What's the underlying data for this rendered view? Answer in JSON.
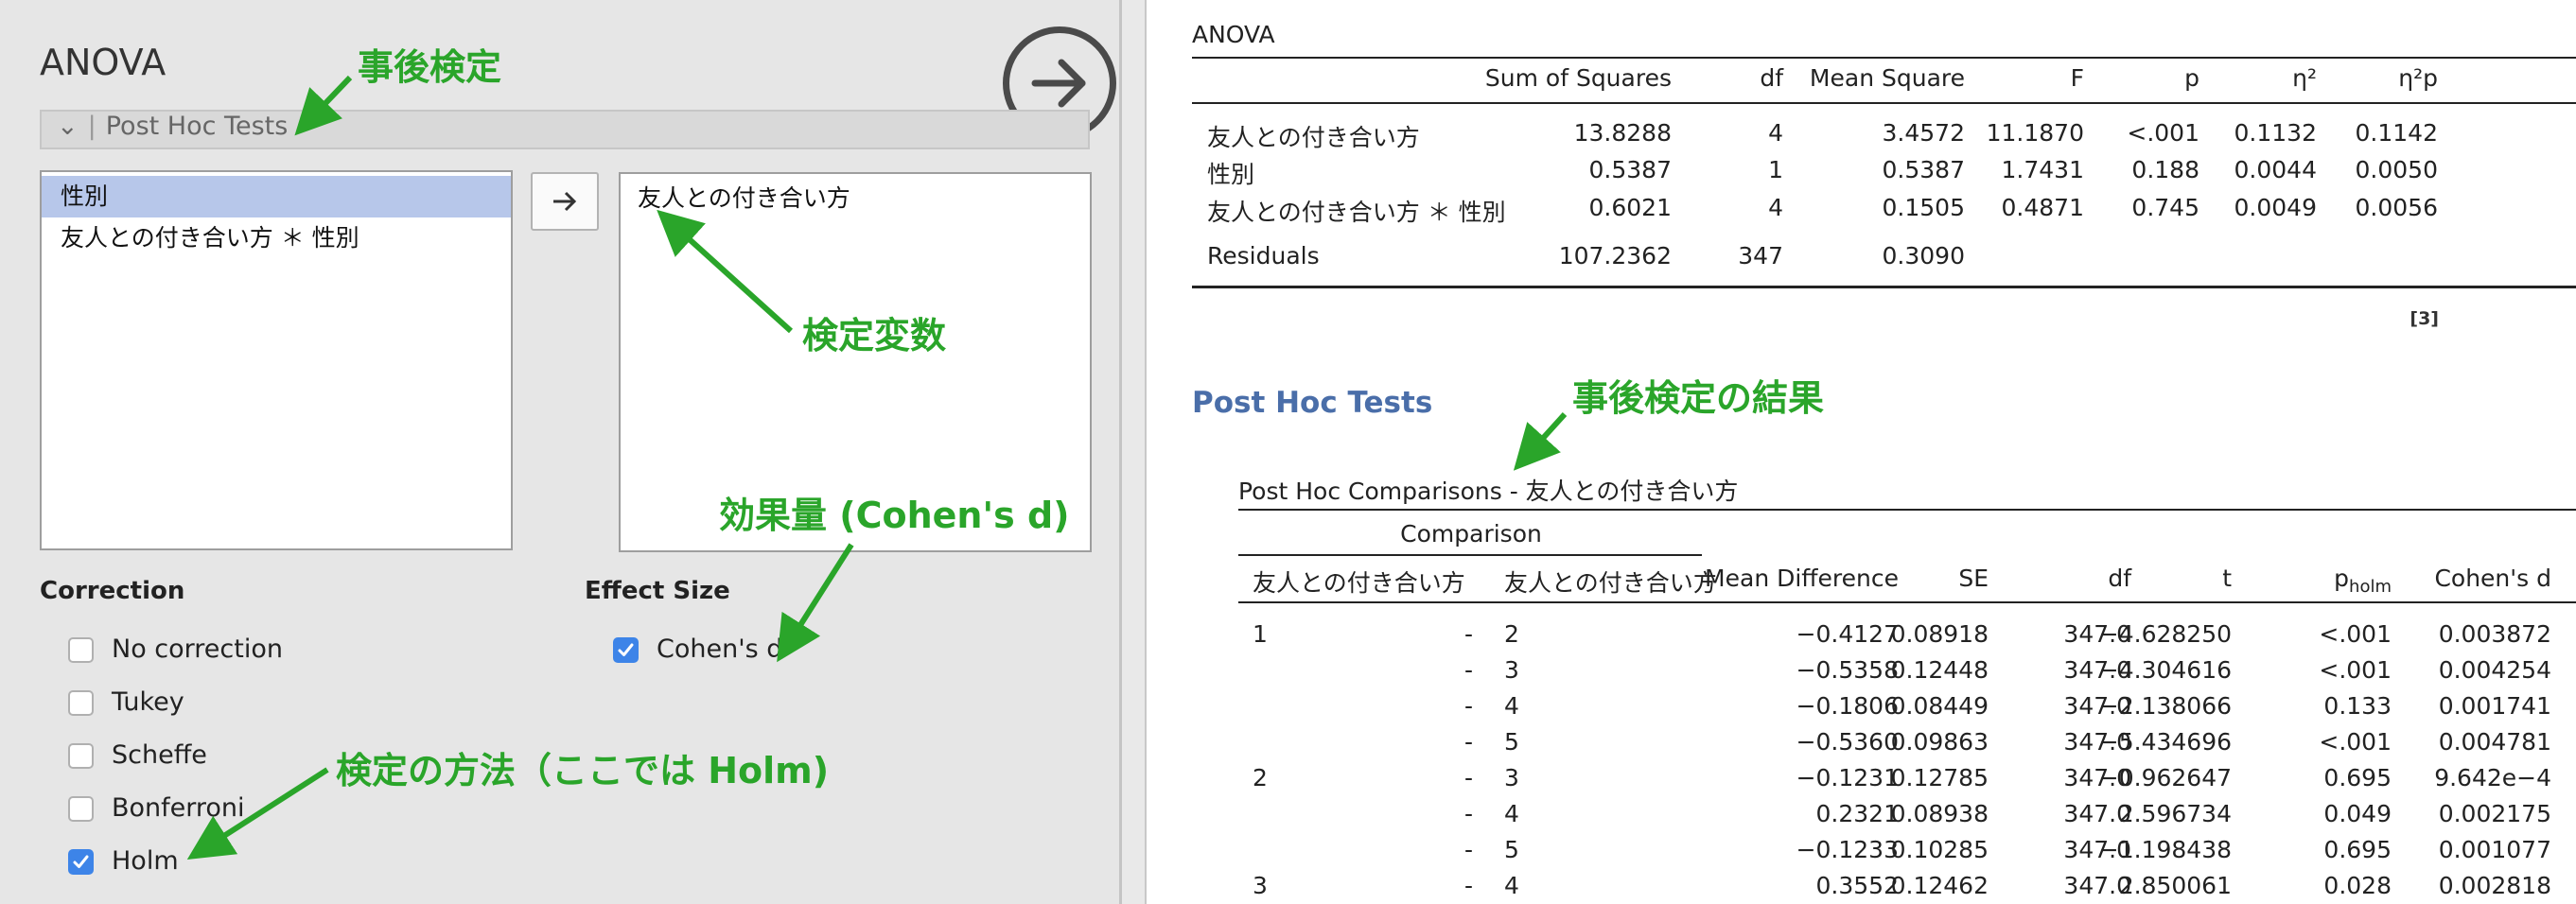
{
  "options_panel": {
    "title": "ANOVA",
    "section_label": "Post Hoc Tests",
    "available_terms": [
      "性別",
      "友人との付き合い方 ＊ 性別"
    ],
    "selected_terms": [
      "友人との付き合い方"
    ],
    "correction": {
      "title": "Correction",
      "options": [
        {
          "label": "No correction",
          "checked": false
        },
        {
          "label": "Tukey",
          "checked": false
        },
        {
          "label": "Scheffe",
          "checked": false
        },
        {
          "label": "Bonferroni",
          "checked": false
        },
        {
          "label": "Holm",
          "checked": true
        }
      ]
    },
    "effect_size": {
      "title": "Effect Size",
      "options": [
        {
          "label": "Cohen's d",
          "checked": true
        }
      ]
    }
  },
  "annotations": {
    "post_hoc": "事後検定",
    "test_variable": "検定変数",
    "effect_size": "効果量 (Cohen's d)",
    "method": "検定の方法（ここでは Holm)",
    "result": "事後検定の結果"
  },
  "anova": {
    "title": "ANOVA",
    "headers": [
      "",
      "Sum of Squares",
      "df",
      "Mean Square",
      "F",
      "p",
      "η²",
      "η²p"
    ],
    "rows": [
      [
        "友人との付き合い方",
        "13.8288",
        "4",
        "3.4572",
        "11.1870",
        "<.001",
        "0.1132",
        "0.1142"
      ],
      [
        "性別",
        "0.5387",
        "1",
        "0.5387",
        "1.7431",
        "0.188",
        "0.0044",
        "0.0050"
      ],
      [
        "友人との付き合い方 ＊ 性別",
        "0.6021",
        "4",
        "0.1505",
        "0.4871",
        "0.745",
        "0.0049",
        "0.0056"
      ],
      [
        "Residuals",
        "107.2362",
        "347",
        "0.3090",
        "",
        "",
        "",
        ""
      ]
    ],
    "ref": "[3]"
  },
  "posthoc": {
    "heading": "Post Hoc Tests",
    "table_title": "Post Hoc Comparisons - 友人との付き合い方",
    "group_header": "Comparison",
    "headers": [
      "友人との付き合い方",
      "",
      "友人との付き合い方",
      "Mean Difference",
      "SE",
      "df",
      "t",
      "p",
      "Cohen's d"
    ],
    "p_subscript": "holm",
    "rows": [
      [
        "1",
        "-",
        "2",
        "−0.4127",
        "0.08918",
        "347.0",
        "−4.628250",
        "<.001",
        "0.003872"
      ],
      [
        "",
        "-",
        "3",
        "−0.5358",
        "0.12448",
        "347.0",
        "−4.304616",
        "<.001",
        "0.004254"
      ],
      [
        "",
        "-",
        "4",
        "−0.1806",
        "0.08449",
        "347.0",
        "−2.138066",
        "0.133",
        "0.001741"
      ],
      [
        "",
        "-",
        "5",
        "−0.5360",
        "0.09863",
        "347.0",
        "−5.434696",
        "<.001",
        "0.004781"
      ],
      [
        "2",
        "-",
        "3",
        "−0.1231",
        "0.12785",
        "347.0",
        "−0.962647",
        "0.695",
        "9.642e−4"
      ],
      [
        "",
        "-",
        "4",
        "0.2321",
        "0.08938",
        "347.0",
        "2.596734",
        "0.049",
        "0.002175"
      ],
      [
        "",
        "-",
        "5",
        "−0.1233",
        "0.10285",
        "347.0",
        "−1.198438",
        "0.695",
        "0.001077"
      ],
      [
        "3",
        "-",
        "4",
        "0.3552",
        "0.12462",
        "347.0",
        "2.850061",
        "0.028",
        "0.002818"
      ]
    ]
  },
  "colors": {
    "annotation": "#2aa52a",
    "checkbox": "#3d84e8",
    "selection": "#b7c7ea",
    "heading": "#4a6ea9"
  }
}
